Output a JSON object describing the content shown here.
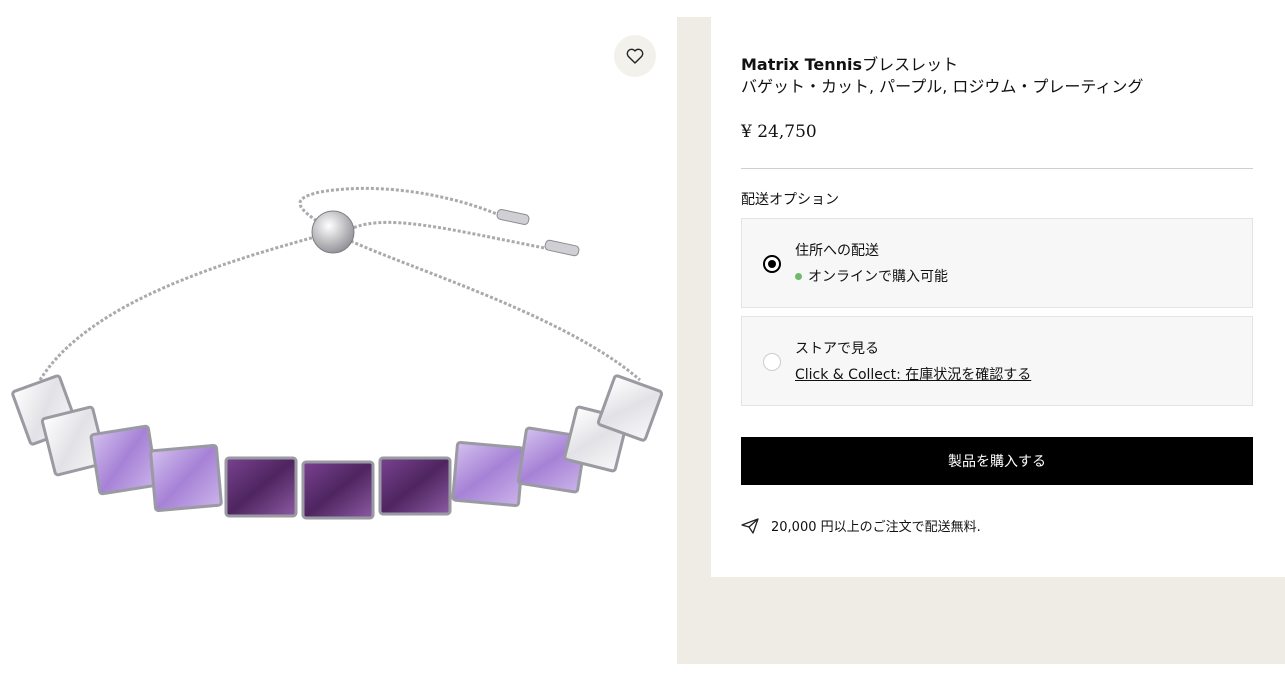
{
  "product": {
    "brand": "Matrix Tennis",
    "type": "ブレスレット",
    "subtitle": "バゲット・カット, パープル, ロジウム・プレーティング",
    "price": "¥ 24,750",
    "image_alt": "Matrix Tennis bracelet with baguette-cut purple and clear crystals"
  },
  "wishlist": {
    "icon": "heart-icon"
  },
  "delivery": {
    "heading": "配送オプション",
    "options": [
      {
        "title": "住所への配送",
        "detail": "オンラインで購入可能",
        "selected": true,
        "status_color": "#6dbb6a"
      },
      {
        "title": "ストアで見る",
        "link": "Click & Collect: 在庫状況を確認する",
        "selected": false
      }
    ]
  },
  "buy_button": {
    "label": "製品を購入する"
  },
  "shipping_note": {
    "icon": "paper-plane-icon",
    "text": "20,000 円以上のご注文で配送無料."
  },
  "colors": {
    "accent": "#000000",
    "panel_bg": "#efece5",
    "stone_dark": "#5a2d6b",
    "stone_light": "#b89ad8"
  }
}
